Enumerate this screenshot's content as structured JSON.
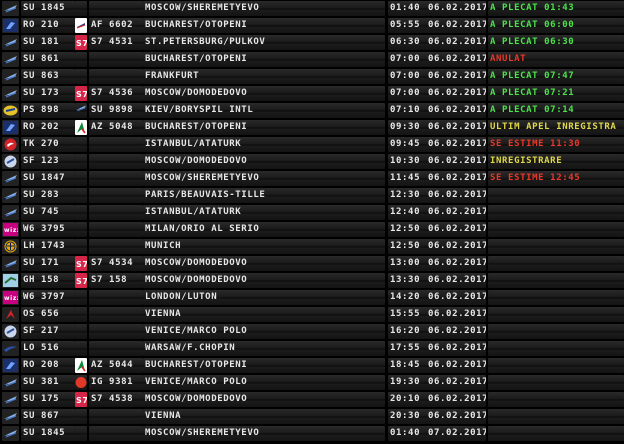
{
  "colors": {
    "green": "#4be34b",
    "red": "#e8392a",
    "yellow": "#e0d84a",
    "text": "#e8e8e8"
  },
  "flights": [
    {
      "airline_icon": "aeroflot-logo-icon",
      "flight": "SU 1845",
      "codeshare_icon": "",
      "codeshare": "",
      "destination": "MOSCOW/SHEREMETYEVO",
      "time": "01:40",
      "date": "06.02.2017",
      "status": "A PLECAT 01:43",
      "status_color": "green"
    },
    {
      "airline_icon": "tarom-logo-icon",
      "flight": "RO 210",
      "codeshare_icon": "air-france-logo-icon",
      "codeshare": "AF 6602",
      "destination": "BUCHAREST/OTOPENI",
      "time": "05:55",
      "date": "06.02.2017",
      "status": "A PLECAT 06:00",
      "status_color": "green"
    },
    {
      "airline_icon": "aeroflot-logo-icon",
      "flight": "SU 181",
      "codeshare_icon": "s7-logo-icon",
      "codeshare": "S7 4531",
      "destination": "ST.PETERSBURG/PULKOV",
      "time": "06:30",
      "date": "06.02.2017",
      "status": "A PLECAT 06:30",
      "status_color": "green"
    },
    {
      "airline_icon": "aeroflot-logo-icon",
      "flight": "SU 861",
      "codeshare_icon": "",
      "codeshare": "",
      "destination": "BUCHAREST/OTOPENI",
      "time": "07:00",
      "date": "06.02.2017",
      "status": "ANULAT",
      "status_color": "red"
    },
    {
      "airline_icon": "aeroflot-logo-icon",
      "flight": "SU 863",
      "codeshare_icon": "",
      "codeshare": "",
      "destination": "FRANKFURT",
      "time": "07:00",
      "date": "06.02.2017",
      "status": "A PLECAT 07:47",
      "status_color": "green"
    },
    {
      "airline_icon": "aeroflot-logo-icon",
      "flight": "SU 173",
      "codeshare_icon": "s7-logo-icon",
      "codeshare": "S7 4536",
      "destination": "MOSCOW/DOMODEDOVO",
      "time": "07:00",
      "date": "06.02.2017",
      "status": "A PLECAT 07:21",
      "status_color": "green"
    },
    {
      "airline_icon": "ukraine-international-logo-icon",
      "flight": "PS 898",
      "codeshare_icon": "aeroflot-logo-icon",
      "codeshare": "SU 9898",
      "destination": "KIEV/BORYSPIL INTL",
      "time": "07:10",
      "date": "06.02.2017",
      "status": "A PLECAT 07:14",
      "status_color": "green"
    },
    {
      "airline_icon": "tarom-logo-icon",
      "flight": "RO 202",
      "codeshare_icon": "alitalia-logo-icon",
      "codeshare": "AZ 5048",
      "destination": "BUCHAREST/OTOPENI",
      "time": "09:30",
      "date": "06.02.2017",
      "status": "ULTIM APEL INREGISTRA",
      "status_color": "yellow"
    },
    {
      "airline_icon": "turkish-airlines-logo-icon",
      "flight": "TK 270",
      "codeshare_icon": "",
      "codeshare": "",
      "destination": "ISTANBUL/ATATURK",
      "time": "09:45",
      "date": "06.02.2017",
      "status": "SE ESTIME 11:30",
      "status_color": "red"
    },
    {
      "airline_icon": "swiss-logo-icon",
      "flight": "SF 123",
      "codeshare_icon": "",
      "codeshare": "",
      "destination": "MOSCOW/DOMODEDOVO",
      "time": "10:30",
      "date": "06.02.2017",
      "status": "INREGISTRARE",
      "status_color": "yellow"
    },
    {
      "airline_icon": "aeroflot-logo-icon",
      "flight": "SU 1847",
      "codeshare_icon": "",
      "codeshare": "",
      "destination": "MOSCOW/SHEREMETYEVO",
      "time": "11:45",
      "date": "06.02.2017",
      "status": "SE ESTIME 12:45",
      "status_color": "red"
    },
    {
      "airline_icon": "aeroflot-logo-icon",
      "flight": "SU 283",
      "codeshare_icon": "",
      "codeshare": "",
      "destination": "PARIS/BEAUVAIS-TILLE",
      "time": "12:30",
      "date": "06.02.2017",
      "status": "",
      "status_color": "default"
    },
    {
      "airline_icon": "aeroflot-logo-icon",
      "flight": "SU 745",
      "codeshare_icon": "",
      "codeshare": "",
      "destination": "ISTANBUL/ATATURK",
      "time": "12:40",
      "date": "06.02.2017",
      "status": "",
      "status_color": "default"
    },
    {
      "airline_icon": "wizz-air-logo-icon",
      "flight": "W6 3795",
      "codeshare_icon": "",
      "codeshare": "",
      "destination": "MILAN/ORIO AL SERIO",
      "time": "12:50",
      "date": "06.02.2017",
      "status": "",
      "status_color": "default"
    },
    {
      "airline_icon": "lufthansa-logo-icon",
      "flight": "LH 1743",
      "codeshare_icon": "",
      "codeshare": "",
      "destination": "MUNICH",
      "time": "12:50",
      "date": "06.02.2017",
      "status": "",
      "status_color": "default"
    },
    {
      "airline_icon": "aeroflot-logo-icon",
      "flight": "SU 171",
      "codeshare_icon": "s7-logo-icon",
      "codeshare": "S7 4534",
      "destination": "MOSCOW/DOMODEDOVO",
      "time": "13:00",
      "date": "06.02.2017",
      "status": "",
      "status_color": "default"
    },
    {
      "airline_icon": "gh-logo-icon",
      "flight": "GH 158",
      "codeshare_icon": "s7-logo-icon",
      "codeshare": "S7 158",
      "destination": "MOSCOW/DOMODEDOVO",
      "time": "13:30",
      "date": "06.02.2017",
      "status": "",
      "status_color": "default"
    },
    {
      "airline_icon": "wizz-air-logo-icon",
      "flight": "W6 3797",
      "codeshare_icon": "",
      "codeshare": "",
      "destination": "LONDON/LUTON",
      "time": "14:20",
      "date": "06.02.2017",
      "status": "",
      "status_color": "default"
    },
    {
      "airline_icon": "austrian-logo-icon",
      "flight": "OS 656",
      "codeshare_icon": "",
      "codeshare": "",
      "destination": "VIENNA",
      "time": "15:55",
      "date": "06.02.2017",
      "status": "",
      "status_color": "default"
    },
    {
      "airline_icon": "swiss-logo-icon",
      "flight": "SF 217",
      "codeshare_icon": "",
      "codeshare": "",
      "destination": "VENICE/MARCO POLO",
      "time": "16:20",
      "date": "06.02.2017",
      "status": "",
      "status_color": "default"
    },
    {
      "airline_icon": "lot-logo-icon",
      "flight": "LO 516",
      "codeshare_icon": "",
      "codeshare": "",
      "destination": "WARSAW/F.CHOPIN",
      "time": "17:55",
      "date": "06.02.2017",
      "status": "",
      "status_color": "default"
    },
    {
      "airline_icon": "tarom-logo-icon",
      "flight": "RO 208",
      "codeshare_icon": "alitalia-logo-icon",
      "codeshare": "AZ 5044",
      "destination": "BUCHAREST/OTOPENI",
      "time": "18:45",
      "date": "06.02.2017",
      "status": "",
      "status_color": "default"
    },
    {
      "airline_icon": "aeroflot-logo-icon",
      "flight": "SU 381",
      "codeshare_icon": "red-circle-logo-icon",
      "codeshare": "IG 9381",
      "destination": "VENICE/MARCO POLO",
      "time": "19:30",
      "date": "06.02.2017",
      "status": "",
      "status_color": "default"
    },
    {
      "airline_icon": "aeroflot-logo-icon",
      "flight": "SU 175",
      "codeshare_icon": "s7-logo-icon",
      "codeshare": "S7 4538",
      "destination": "MOSCOW/DOMODEDOVO",
      "time": "20:10",
      "date": "06.02.2017",
      "status": "",
      "status_color": "default"
    },
    {
      "airline_icon": "aeroflot-logo-icon",
      "flight": "SU 867",
      "codeshare_icon": "",
      "codeshare": "",
      "destination": "VIENNA",
      "time": "20:30",
      "date": "06.02.2017",
      "status": "",
      "status_color": "default"
    },
    {
      "airline_icon": "aeroflot-logo-icon",
      "flight": "SU 1845",
      "codeshare_icon": "",
      "codeshare": "",
      "destination": "MOSCOW/SHEREMETYEVO",
      "time": "01:40",
      "date": "07.02.2017",
      "status": "",
      "status_color": "default"
    }
  ]
}
